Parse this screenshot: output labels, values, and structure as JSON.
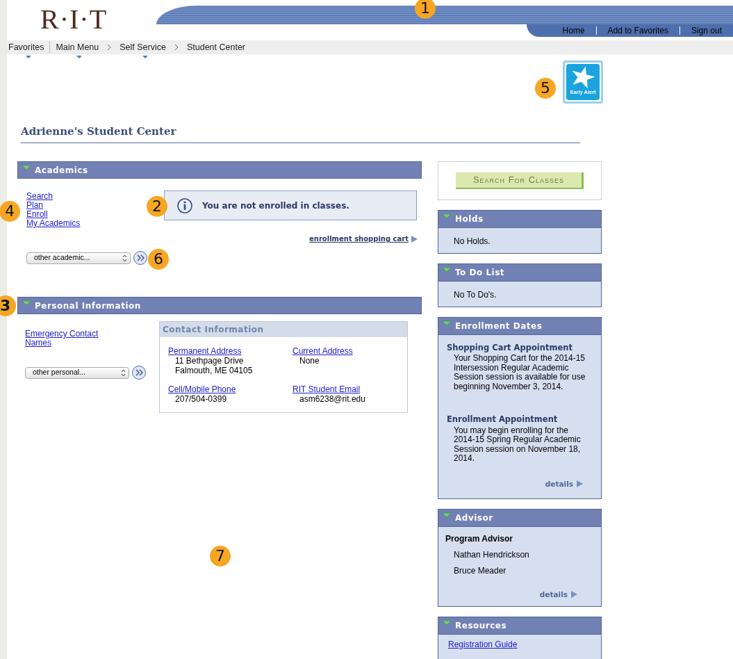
{
  "header": {
    "logo": "R·I·T",
    "callout": "1",
    "links": [
      "Home",
      "Add to Favorites",
      "Sign out"
    ]
  },
  "breadcrumb": [
    {
      "label": "Favorites",
      "menu": true
    },
    {
      "label": "Main Menu",
      "menu": true
    },
    {
      "label": "Self Service",
      "menu": true
    },
    {
      "label": "Student Center",
      "menu": false
    }
  ],
  "early_alert": {
    "label": "Early Alert",
    "callout": "5"
  },
  "page_title": "Adrienne's Student Center",
  "academics": {
    "title": "Academics",
    "expanded": true,
    "links": [
      "Search",
      "Plan",
      "Enroll",
      "My Academics"
    ],
    "links_callout": "4",
    "message": "You are not enrolled in classes.",
    "message_callout": "2",
    "cart_link": "enrollment shopping cart",
    "dropdown": "other academic...",
    "dropdown_callout": "6"
  },
  "personal": {
    "title": "Personal Information",
    "expanded": true,
    "callout": "3",
    "links": [
      "Emergency Contact Names"
    ],
    "dropdown": "other personal...",
    "contact": {
      "title": "Contact Information",
      "fields": [
        {
          "label": "Permanent Address",
          "lines": [
            "11 Bethpage Drive",
            "Falmouth, ME 04105"
          ]
        },
        {
          "label": "Current Address",
          "lines": [
            "None"
          ]
        },
        {
          "label": "Cell/Mobile Phone",
          "lines": [
            "207/504-0399"
          ]
        },
        {
          "label": "RIT Student Email",
          "lines": [
            "asm6238@rit.edu"
          ]
        }
      ]
    }
  },
  "empty_area_callout": "7",
  "search_button": "Search For Classes",
  "sidebar": [
    {
      "kind": "text",
      "title": "Holds",
      "expanded": true,
      "text": "No Holds."
    },
    {
      "kind": "text",
      "title": "To Do List",
      "expanded": true,
      "text": "No To Do's."
    },
    {
      "kind": "dates",
      "title": "Enrollment Dates",
      "expanded": true,
      "entries": [
        {
          "heading": "Shopping Cart Appointment",
          "text": "Your Shopping Cart for the 2014-15 Intersession Regular Academic Session session is available for use beginning November 3, 2014."
        },
        {
          "heading": "Enrollment Appointment",
          "text": "You may begin enrolling for the 2014-15 Spring Regular Academic Session session on November 18, 2014."
        }
      ],
      "details": "details"
    },
    {
      "kind": "advisor",
      "title": "Advisor",
      "expanded": true,
      "heading": "Program Advisor",
      "names": [
        "Nathan Hendrickson",
        "Bruce Meader"
      ],
      "details": "details"
    },
    {
      "kind": "links",
      "title": "Resources",
      "expanded": true,
      "links": [
        "Registration Guide"
      ]
    }
  ]
}
